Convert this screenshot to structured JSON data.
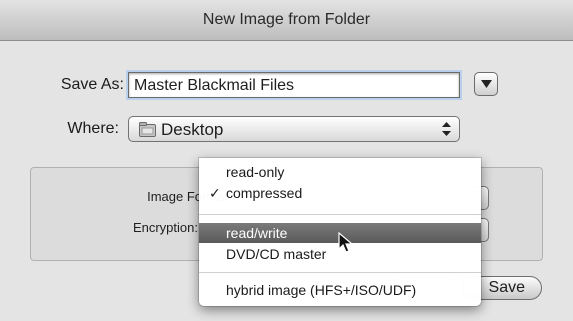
{
  "window": {
    "title": "New Image from Folder"
  },
  "form": {
    "save_as_label": "Save As:",
    "save_as_value": "Master Blackmail Files",
    "where_label": "Where:",
    "where_value": "Desktop"
  },
  "options": {
    "image_format_label": "Image Format",
    "encryption_label": "Encryption:"
  },
  "menu": {
    "items": [
      {
        "label": "read-only",
        "checked": false
      },
      {
        "label": "compressed",
        "checked": true
      },
      {
        "label": "read/write",
        "checked": false,
        "highlighted": true
      },
      {
        "label": "DVD/CD master",
        "checked": false
      },
      {
        "label": "hybrid image (HFS+/ISO/UDF)",
        "checked": false
      }
    ],
    "check_glyph": "✓"
  },
  "buttons": {
    "save_label": "Save"
  },
  "icons": {
    "disclosure": "chevron-down-icon",
    "folder": "folder-icon",
    "stepper": "updown-arrows-icon",
    "cursor": "mouse-pointer-icon"
  }
}
